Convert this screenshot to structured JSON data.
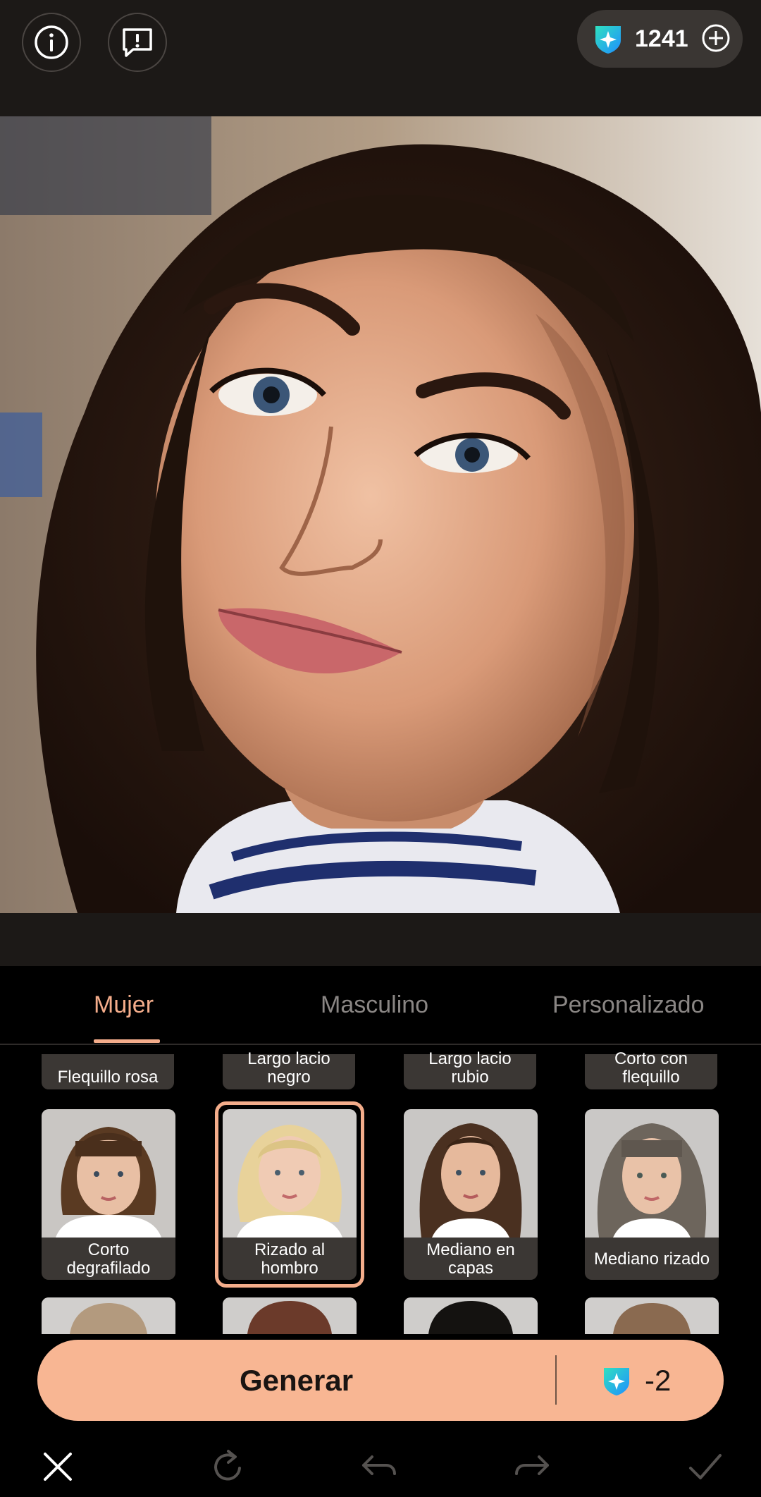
{
  "header": {
    "info_icon": "info-icon",
    "report_icon": "report-icon",
    "credits": "1241",
    "credit_icon": "credit-gem-icon",
    "add_icon": "plus-circle-icon"
  },
  "tabs": [
    {
      "label": "Mujer",
      "active": true
    },
    {
      "label": "Masculino",
      "active": false
    },
    {
      "label": "Personalizado",
      "active": false
    }
  ],
  "styles_top_row": [
    "Flequillo rosa",
    "Largo lacio negro",
    "Largo lacio rubio",
    "Corto con flequillo"
  ],
  "styles_row": [
    {
      "label": "Corto degrafilado",
      "hair": "#5a3a22",
      "selected": false
    },
    {
      "label": "Rizado al hombro",
      "hair": "#e8d29a",
      "selected": true
    },
    {
      "label": "Mediano en capas",
      "hair": "#4a3020",
      "selected": false
    },
    {
      "label": "Mediano rizado",
      "hair": "#6d655c",
      "selected": false
    }
  ],
  "generate": {
    "label": "Generar",
    "cost": "-2"
  },
  "toolbar": {
    "close_icon": "close-icon",
    "refresh_icon": "refresh-icon",
    "undo_icon": "undo-icon",
    "redo_icon": "redo-icon",
    "confirm_icon": "check-icon"
  },
  "colors": {
    "accent": "#f4ad8b",
    "button": "#f8b693",
    "topbar": "#1c1917"
  }
}
